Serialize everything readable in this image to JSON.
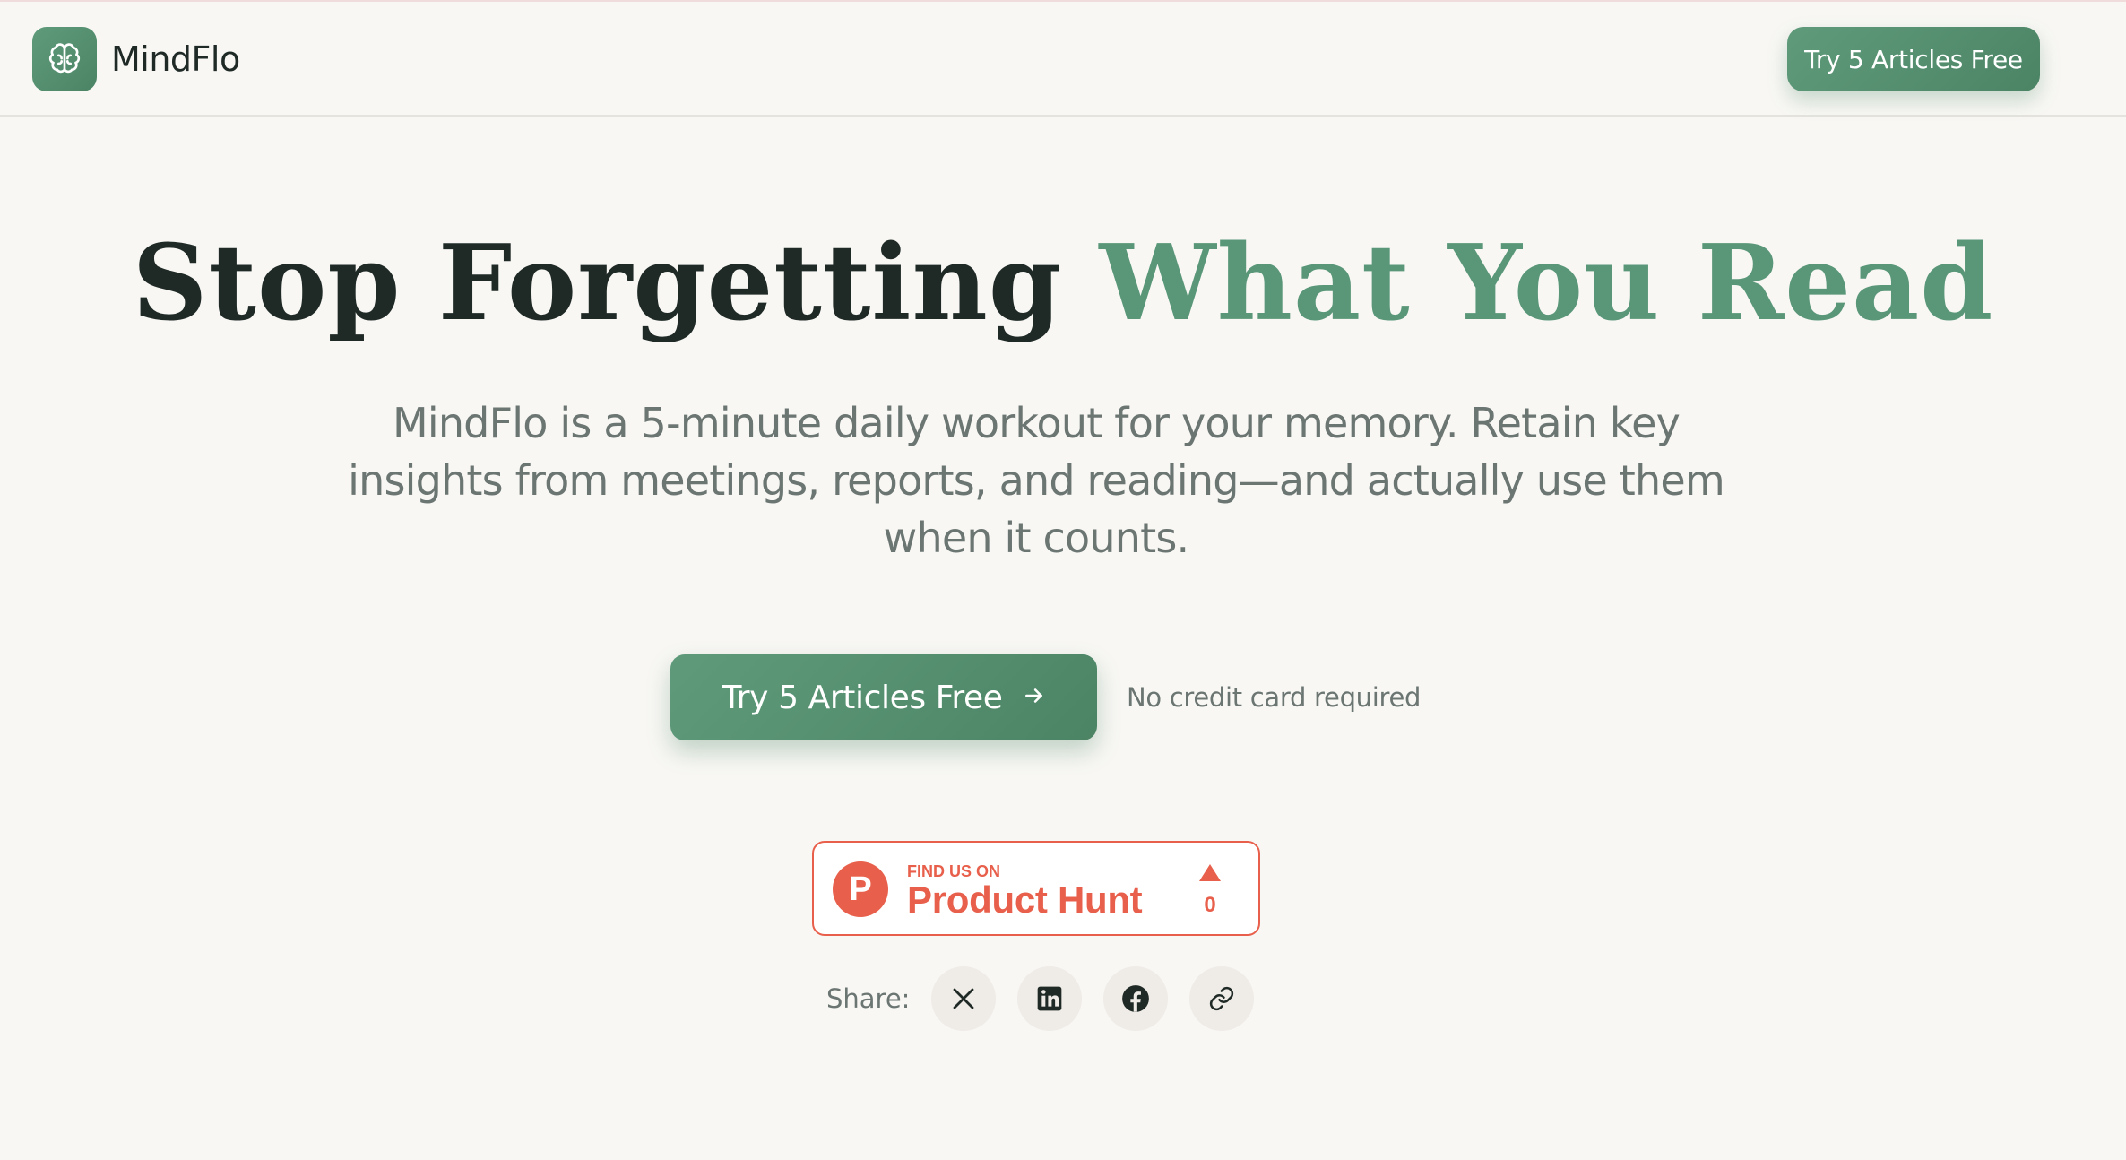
{
  "header": {
    "brand_name": "MindFlo",
    "logo_icon": "brain-icon",
    "cta_label": "Try 5 Articles Free"
  },
  "hero": {
    "title_part1": "Stop Forgetting",
    "title_part2": "What You Read",
    "subtitle": "MindFlo is a 5-minute daily workout for your memory. Retain key insights from meetings, reports, and reading—and actually use them when it counts.",
    "cta_label": "Try 5 Articles Free",
    "cta_icon": "arrow-right-icon",
    "cta_note": "No credit card required"
  },
  "product_hunt": {
    "small_text": "FIND US ON",
    "big_text": "Product Hunt",
    "logo_letter": "P",
    "upvote_count": "0"
  },
  "share": {
    "label": "Share:",
    "buttons": [
      {
        "icon": "x-icon"
      },
      {
        "icon": "linkedin-icon"
      },
      {
        "icon": "facebook-icon"
      },
      {
        "icon": "link-icon"
      }
    ]
  },
  "colors": {
    "brand_green": "#5a9778",
    "background": "#f8f7f4",
    "product_hunt": "#e8604c",
    "heading": "#1f2a27",
    "muted_text": "#6b7572"
  }
}
